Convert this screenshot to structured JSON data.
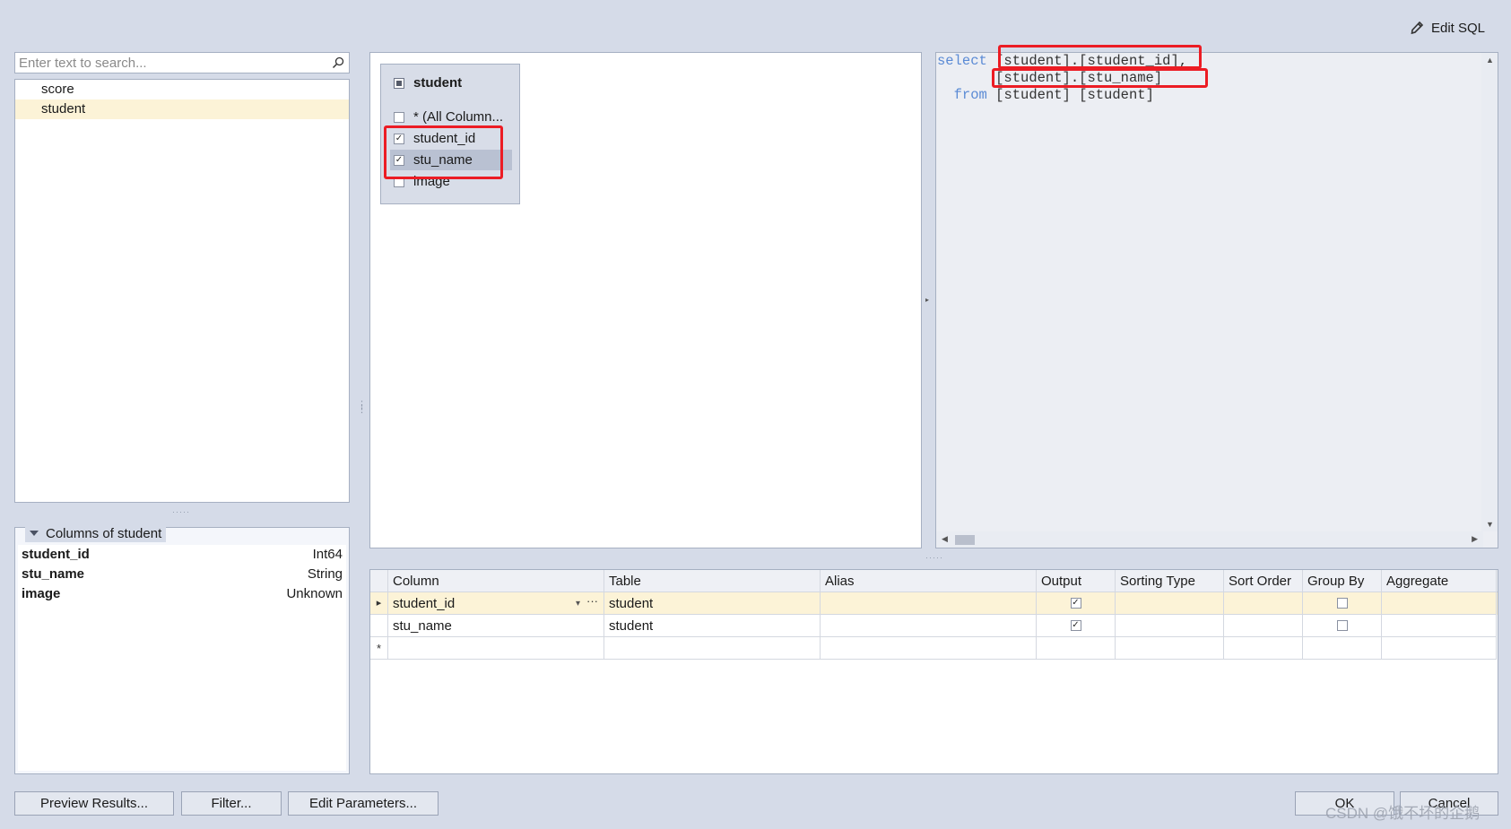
{
  "toolbar": {
    "edit_sql_label": "Edit SQL",
    "edit_sql_icon": "pencil-icon"
  },
  "search": {
    "placeholder": "Enter text to search..."
  },
  "tables": [
    "score",
    "student"
  ],
  "selected_table": "student",
  "columns_panel": {
    "title": "Columns of student",
    "rows": [
      {
        "name": "student_id",
        "type": "Int64"
      },
      {
        "name": "stu_name",
        "type": "String"
      },
      {
        "name": "image",
        "type": "Unknown"
      }
    ]
  },
  "diagram": {
    "table_name": "student",
    "fields": [
      {
        "label": "* (All Column...",
        "checked": false
      },
      {
        "label": "student_id",
        "checked": true
      },
      {
        "label": "stu_name",
        "checked": true
      },
      {
        "label": "image",
        "checked": false
      }
    ]
  },
  "sql": {
    "line1_kw": "select",
    "line1_val": "[student].[student_id]",
    "line1_tail": ",",
    "line2_val": "[student].[stu_name]",
    "line3_kw": "from",
    "line3_val": "[student] [student]"
  },
  "grid": {
    "headers": [
      "Column",
      "Table",
      "Alias",
      "Output",
      "Sorting Type",
      "Sort Order",
      "Group By",
      "Aggregate"
    ],
    "rows": [
      {
        "indicator": "▸",
        "column": "student_id",
        "table": "student",
        "alias": "",
        "output": true,
        "sorting_type": "",
        "sort_order": "",
        "group_by": false,
        "aggregate": "",
        "dropdown_icon": "▾",
        "ellipsis": "···"
      },
      {
        "indicator": "",
        "column": "stu_name",
        "table": "student",
        "alias": "",
        "output": true,
        "sorting_type": "",
        "sort_order": "",
        "group_by": false,
        "aggregate": ""
      },
      {
        "indicator": "*",
        "column": "",
        "table": "",
        "alias": "",
        "output": null,
        "sorting_type": "",
        "sort_order": "",
        "group_by": null,
        "aggregate": ""
      }
    ]
  },
  "buttons": {
    "preview": "Preview Results...",
    "filter": "Filter...",
    "edit_params": "Edit Parameters...",
    "ok": "OK",
    "cancel": "Cancel"
  },
  "watermark": "CSDN @饿不坏的企鹅",
  "colors": {
    "highlight_red": "#ec1c24",
    "selected_row": "#fcf3d7",
    "sql_keyword": "#5b8bd5"
  }
}
